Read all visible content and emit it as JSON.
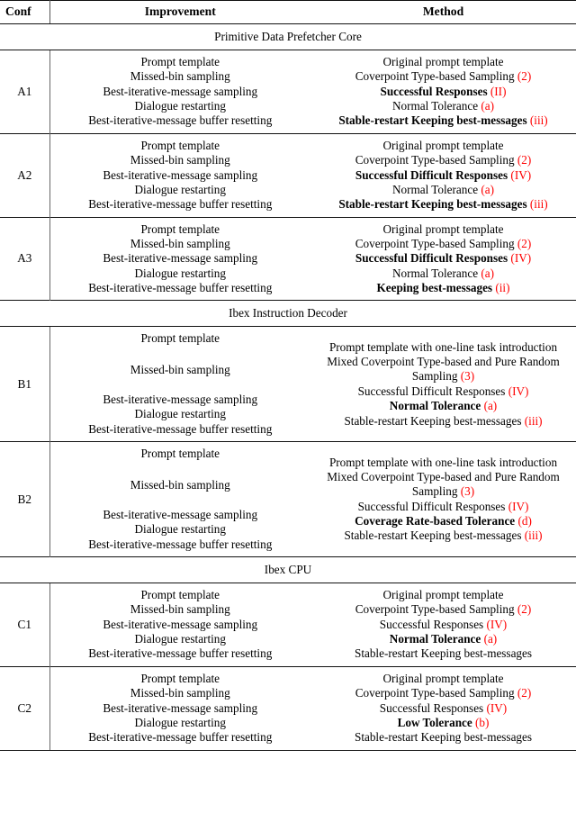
{
  "table": {
    "columns": [
      "Conf",
      "Improvement",
      "Method"
    ],
    "accent_red": "#ff0000",
    "improvement_steps": [
      "Prompt template",
      "Missed-bin sampling",
      "Best-iterative-message sampling",
      "Dialogue restarting",
      "Best-iterative-message buffer resetting"
    ],
    "sections": [
      {
        "title": "Primitive Data Prefetcher Core",
        "rows": [
          {
            "conf": "A1",
            "improvements": [
              "Prompt template",
              "Missed-bin sampling",
              "Best-iterative-message sampling",
              "Dialogue restarting",
              "Best-iterative-message buffer resetting"
            ],
            "methods": [
              {
                "text": "Original prompt template",
                "bold": false,
                "tag": ""
              },
              {
                "text": "Coverpoint Type-based Sampling",
                "bold": false,
                "tag": "(2)"
              },
              {
                "text": "Successful Responses",
                "bold": true,
                "tag": "(II)"
              },
              {
                "text": "Normal Tolerance",
                "bold": false,
                "tag": "(a)"
              },
              {
                "text": "Stable-restart Keeping best-messages",
                "bold": true,
                "tag": "(iii)"
              }
            ]
          },
          {
            "conf": "A2",
            "improvements": [
              "Prompt template",
              "Missed-bin sampling",
              "Best-iterative-message sampling",
              "Dialogue restarting",
              "Best-iterative-message buffer resetting"
            ],
            "methods": [
              {
                "text": "Original prompt template",
                "bold": false,
                "tag": ""
              },
              {
                "text": "Coverpoint Type-based Sampling",
                "bold": false,
                "tag": "(2)"
              },
              {
                "text": "Successful Difficult Responses",
                "bold": true,
                "tag": "(IV)"
              },
              {
                "text": "Normal Tolerance",
                "bold": false,
                "tag": "(a)"
              },
              {
                "text": "Stable-restart Keeping best-messages",
                "bold": true,
                "tag": "(iii)"
              }
            ]
          },
          {
            "conf": "A3",
            "improvements": [
              "Prompt template",
              "Missed-bin sampling",
              "Best-iterative-message sampling",
              "Dialogue restarting",
              "Best-iterative-message buffer resetting"
            ],
            "methods": [
              {
                "text": "Original prompt template",
                "bold": false,
                "tag": ""
              },
              {
                "text": "Coverpoint Type-based Sampling",
                "bold": false,
                "tag": "(2)"
              },
              {
                "text": "Successful Difficult Responses",
                "bold": true,
                "tag": "(IV)"
              },
              {
                "text": "Normal Tolerance",
                "bold": false,
                "tag": "(a)"
              },
              {
                "text": "Keeping best-messages",
                "bold": true,
                "tag": "(ii)"
              }
            ]
          }
        ]
      },
      {
        "title": "Ibex Instruction Decoder",
        "rows": [
          {
            "conf": "B1",
            "improvements": [
              "Prompt template",
              "Missed-bin sampling",
              "Best-iterative-message sampling",
              "Dialogue restarting",
              "Best-iterative-message buffer resetting"
            ],
            "methods": [
              {
                "text": "Prompt template with one-line task introduction",
                "bold": false,
                "tag": ""
              },
              {
                "text": "Mixed Coverpoint Type-based and Pure Random Sampling",
                "bold": false,
                "tag": "(3)"
              },
              {
                "text": "Successful Difficult Responses",
                "bold": false,
                "tag": "(IV)"
              },
              {
                "text": "Normal Tolerance",
                "bold": true,
                "tag": "(a)"
              },
              {
                "text": "Stable-restart Keeping best-messages",
                "bold": false,
                "tag": "(iii)"
              }
            ]
          },
          {
            "conf": "B2",
            "improvements": [
              "Prompt template",
              "Missed-bin sampling",
              "Best-iterative-message sampling",
              "Dialogue restarting",
              "Best-iterative-message buffer resetting"
            ],
            "methods": [
              {
                "text": "Prompt template with one-line task introduction",
                "bold": false,
                "tag": ""
              },
              {
                "text": "Mixed Coverpoint Type-based and Pure Random Sampling",
                "bold": false,
                "tag": "(3)"
              },
              {
                "text": "Successful Difficult Responses",
                "bold": false,
                "tag": "(IV)"
              },
              {
                "text": "Coverage Rate-based Tolerance",
                "bold": true,
                "tag": "(d)"
              },
              {
                "text": "Stable-restart Keeping best-messages",
                "bold": false,
                "tag": "(iii)"
              }
            ]
          }
        ]
      },
      {
        "title": "Ibex CPU",
        "rows": [
          {
            "conf": "C1",
            "improvements": [
              "Prompt template",
              "Missed-bin sampling",
              "Best-iterative-message sampling",
              "Dialogue restarting",
              "Best-iterative-message buffer resetting"
            ],
            "methods": [
              {
                "text": "Original prompt template",
                "bold": false,
                "tag": ""
              },
              {
                "text": "Coverpoint Type-based Sampling",
                "bold": false,
                "tag": "(2)"
              },
              {
                "text": "Successful Responses",
                "bold": false,
                "tag": "(IV)"
              },
              {
                "text": "Normal Tolerance",
                "bold": true,
                "tag": "(a)"
              },
              {
                "text": "Stable-restart Keeping best-messages",
                "bold": false,
                "tag": ""
              }
            ]
          },
          {
            "conf": "C2",
            "improvements": [
              "Prompt template",
              "Missed-bin sampling",
              "Best-iterative-message sampling",
              "Dialogue restarting",
              "Best-iterative-message buffer resetting"
            ],
            "methods": [
              {
                "text": "Original prompt template",
                "bold": false,
                "tag": ""
              },
              {
                "text": "Coverpoint Type-based Sampling",
                "bold": false,
                "tag": "(2)"
              },
              {
                "text": "Successful Responses",
                "bold": false,
                "tag": "(IV)"
              },
              {
                "text": "Low Tolerance",
                "bold": true,
                "tag": "(b)"
              },
              {
                "text": "Stable-restart Keeping best-messages",
                "bold": false,
                "tag": ""
              }
            ]
          }
        ]
      }
    ]
  }
}
